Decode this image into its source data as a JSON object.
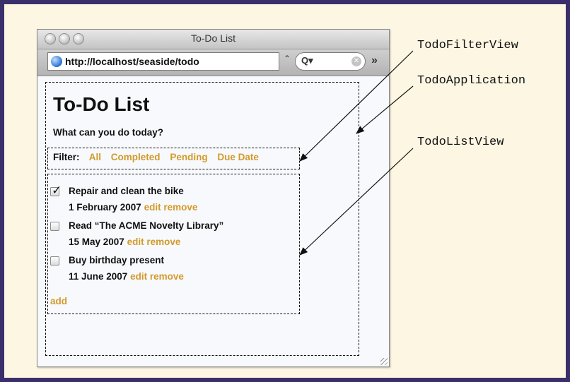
{
  "window": {
    "title": "To-Do List"
  },
  "toolbar": {
    "url": "http://localhost/seaside/todo",
    "search_icon": "magnifier-icon",
    "overflow": "»"
  },
  "app": {
    "heading": "To-Do List",
    "subheading": "What can you do today?",
    "filter_label": "Filter:",
    "filters": [
      "All",
      "Completed",
      "Pending",
      "Due Date"
    ],
    "items": [
      {
        "title": "Repair and clean the bike",
        "date": "1 February 2007",
        "checked": true
      },
      {
        "title": "Read “The ACME Novelty Library”",
        "date": "15 May 2007",
        "checked": false
      },
      {
        "title": "Buy birthday present",
        "date": "11 June 2007",
        "checked": false
      }
    ],
    "edit_label": "edit",
    "remove_label": "remove",
    "add_label": "add"
  },
  "annotations": {
    "filter_view": "TodoFilterView",
    "application": "TodoApplication",
    "list_view": "TodoListView"
  },
  "colors": {
    "background": "#fdf6e3",
    "border": "#3a2f6b",
    "link": "#d39a2a"
  }
}
